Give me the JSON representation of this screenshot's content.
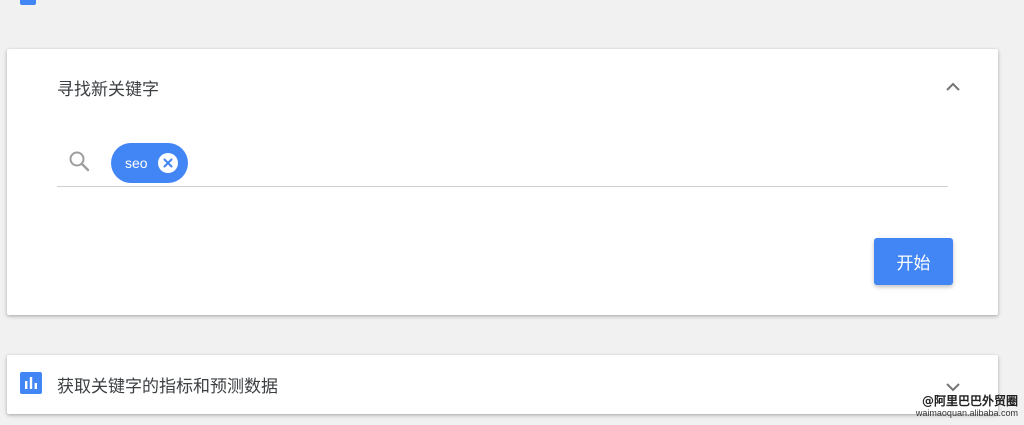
{
  "colors": {
    "accent": "#4285f4",
    "card_bg": "#ffffff",
    "page_bg": "#f1f1f1",
    "text": "#3c4043"
  },
  "find_keywords": {
    "title": "寻找新关键字",
    "collapse_icon": "chevron-up-icon",
    "search_icon": "search-icon",
    "chips": [
      {
        "label": "seo",
        "remove_icon": "close-circle-icon"
      }
    ],
    "input_value": "",
    "start_button": "开始"
  },
  "metrics": {
    "icon": "bar-chart-icon",
    "title": "获取关键字的指标和预测数据",
    "expand_icon": "chevron-down-icon"
  },
  "watermark": {
    "line1": "@阿里巴巴外贸圈",
    "line2": "waimaoquan.alibaba.com"
  }
}
